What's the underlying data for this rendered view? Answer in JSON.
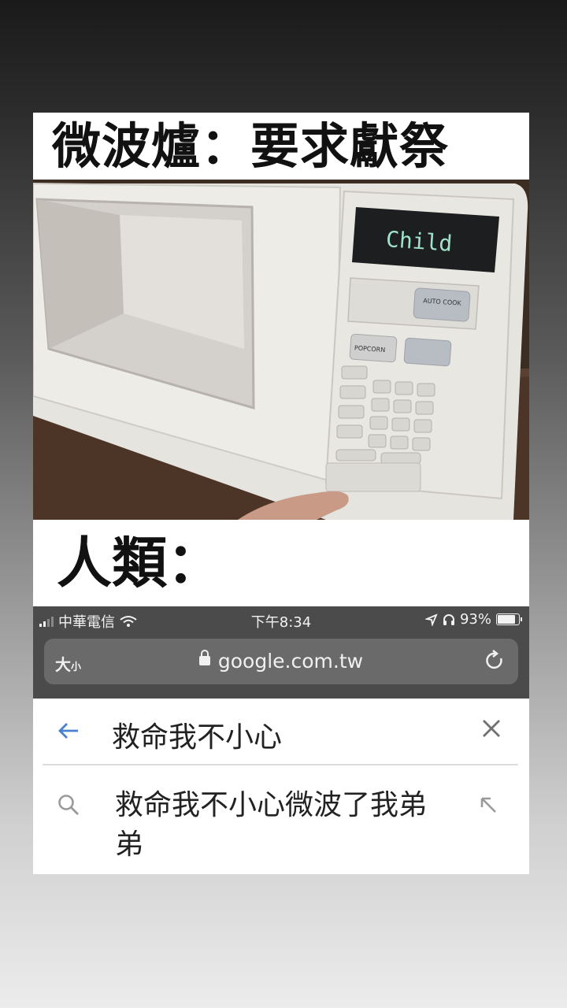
{
  "meme": {
    "top_caption": "微波爐：要求獻祭",
    "mid_caption": "人類："
  },
  "photo": {
    "display_text": "Child",
    "auto_cook_label": "AUTO COOK",
    "popcorn_label": "POPCORN"
  },
  "statusbar": {
    "carrier": "中華電信",
    "time": "下午8:34",
    "battery_percent": "93%",
    "battery_level": 0.93,
    "icons": [
      "signal-icon",
      "wifi-icon",
      "location-icon",
      "headphones-icon",
      "battery-icon"
    ]
  },
  "browser": {
    "text_size_label_big": "大",
    "text_size_label_small": "小",
    "url": "google.com.tw",
    "icons": [
      "lock-icon",
      "reload-icon"
    ]
  },
  "search": {
    "query": "救命我不小心",
    "suggestions": [
      {
        "text": "救命我不小心微波了我弟弟"
      }
    ],
    "icons": [
      "back-arrow-icon",
      "clear-icon",
      "search-icon",
      "fill-query-arrow-icon"
    ],
    "accent_color": "#4a80d0"
  }
}
